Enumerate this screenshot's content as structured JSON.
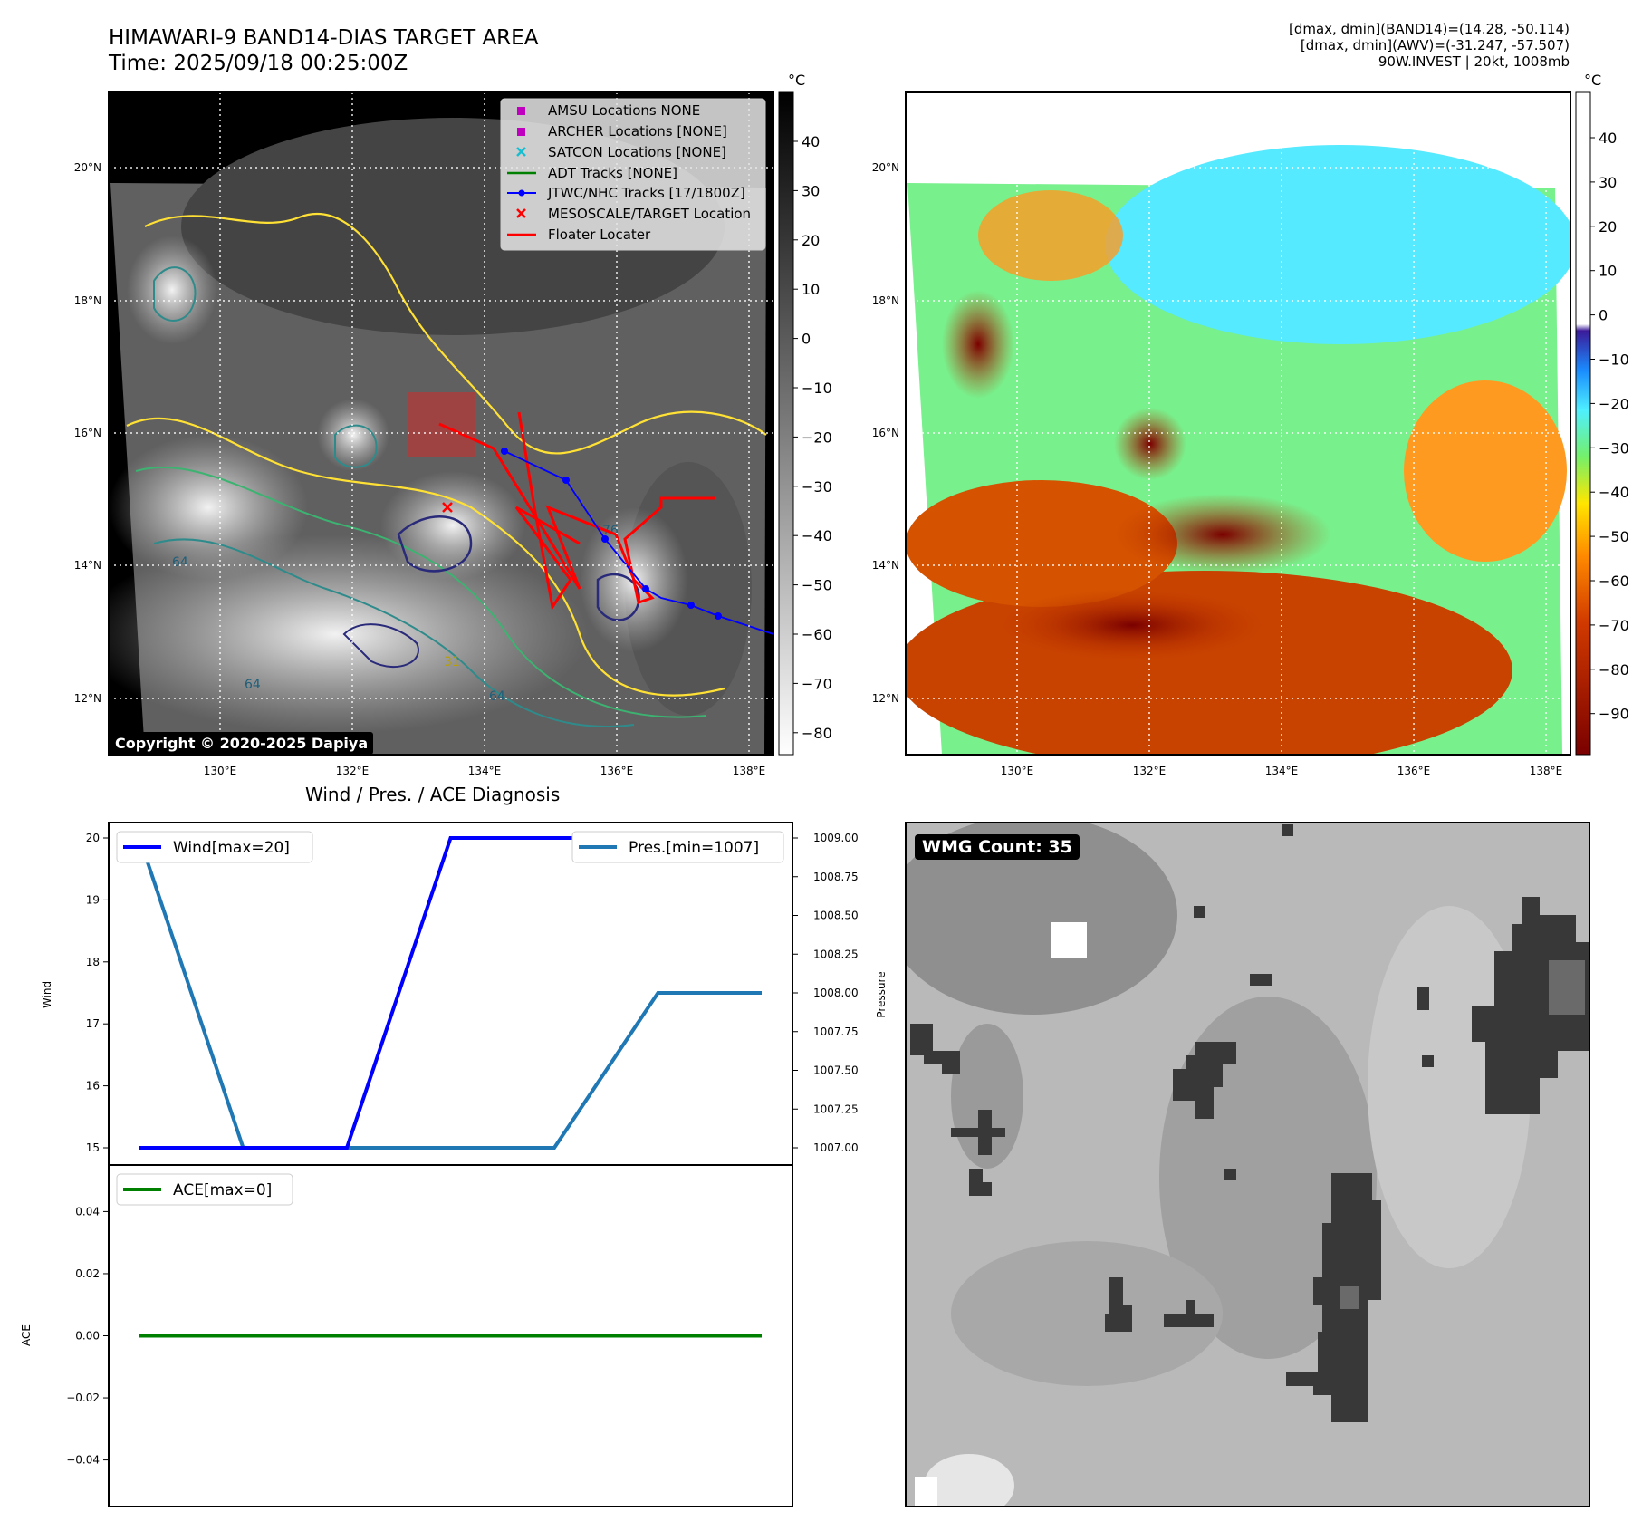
{
  "header": {
    "title_line1": "HIMAWARI-9 BAND14-DIAS TARGET AREA",
    "title_line2": "Time: 2025/09/18 00:25:00Z",
    "info_line1": "[dmax, dmin](BAND14)=(14.28, -50.114)",
    "info_line2": "[dmax, dmin](AWV)=(-31.247, -57.507)",
    "info_line3": "90W.INVEST | 20kt, 1008mb"
  },
  "map_axes": {
    "lat_ticks": [
      "20°N",
      "18°N",
      "16°N",
      "14°N",
      "12°N"
    ],
    "lon_ticks": [
      "130°E",
      "132°E",
      "134°E",
      "136°E",
      "138°E"
    ]
  },
  "ir_panel": {
    "colorbar_unit": "°C",
    "colorbar_ticks": [
      "40",
      "30",
      "20",
      "10",
      "0",
      "−10",
      "−20",
      "−30",
      "−40",
      "−50",
      "−60",
      "−70",
      "−80"
    ],
    "copyright": "Copyright © 2020-2025 Dapiya",
    "legend": [
      {
        "label": "AMSU Locations NONE",
        "marker": "square",
        "color": "#bf00bf"
      },
      {
        "label": "ARCHER Locations [NONE]",
        "marker": "square",
        "color": "#bf00bf"
      },
      {
        "label": "SATCON Locations [NONE]",
        "marker": "x",
        "color": "#17becf"
      },
      {
        "label": "ADT Tracks [NONE]",
        "marker": "line",
        "color": "#008000"
      },
      {
        "label": "JTWC/NHC Tracks [17/1800Z]",
        "marker": "dotline",
        "color": "#0000ff"
      },
      {
        "label": "MESOSCALE/TARGET Location",
        "marker": "x",
        "color": "#ff0000"
      },
      {
        "label": "Floater Locater",
        "marker": "line",
        "color": "#ff0000"
      }
    ],
    "contour_labels": [
      "64",
      "64",
      "64",
      "31",
      "76"
    ]
  },
  "awv_panel": {
    "colorbar_unit": "°C",
    "colorbar_ticks": [
      "40",
      "30",
      "20",
      "10",
      "0",
      "−10",
      "−20",
      "−30",
      "−40",
      "−50",
      "−60",
      "−70",
      "−80",
      "−90"
    ]
  },
  "diagnosis": {
    "title": "Wind / Pres. / ACE Diagnosis",
    "wind_ylabel": "Wind",
    "pres_ylabel": "Pressure",
    "ace_ylabel": "ACE",
    "wind_legend": "Wind[max=20]",
    "pres_legend": "Pres.[min=1007]",
    "ace_legend": "ACE[max=0]"
  },
  "wmg_panel": {
    "label": "WMG Count: 35"
  },
  "chart_data": [
    {
      "type": "line",
      "name": "wind",
      "x": [
        0,
        1,
        2,
        3,
        4,
        5,
        6
      ],
      "values": [
        15,
        15,
        15,
        20,
        20,
        20,
        20
      ],
      "ylim": [
        15,
        20
      ],
      "yticks": [
        "20",
        "19",
        "18",
        "17",
        "16",
        "15"
      ],
      "color": "#0000ff"
    },
    {
      "type": "line",
      "name": "pressure",
      "x": [
        0,
        1,
        2,
        3,
        4,
        5,
        6
      ],
      "values": [
        1009,
        1007,
        1007,
        1007,
        1007,
        1008,
        1008
      ],
      "ylim": [
        1007,
        1009
      ],
      "yticks": [
        "1009.00",
        "1008.75",
        "1008.50",
        "1008.25",
        "1008.00",
        "1007.75",
        "1007.50",
        "1007.25",
        "1007.00"
      ],
      "color": "#1f77b4"
    },
    {
      "type": "line",
      "name": "ace",
      "x": [
        0,
        1,
        2,
        3,
        4,
        5,
        6
      ],
      "values": [
        0,
        0,
        0,
        0,
        0,
        0,
        0
      ],
      "ylim": [
        -0.055,
        0.055
      ],
      "yticks": [
        "0.04",
        "0.02",
        "0.00",
        "−0.02",
        "−0.04"
      ],
      "color": "#008000"
    }
  ]
}
